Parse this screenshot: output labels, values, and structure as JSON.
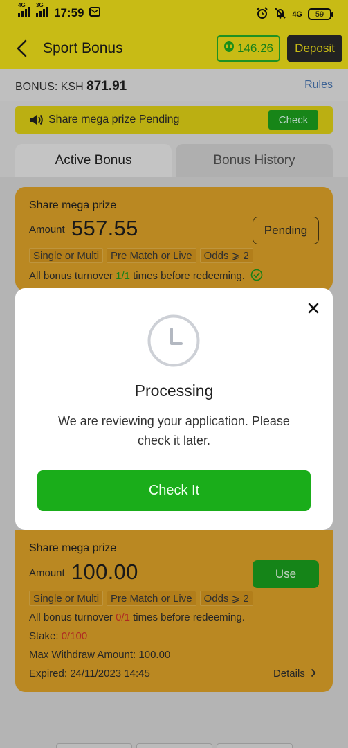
{
  "status_bar": {
    "net1": "4G",
    "net2": "3G",
    "time": "17:59",
    "net3": "4G",
    "battery": "59"
  },
  "header": {
    "title": "Sport Bonus",
    "balance": "146.26",
    "deposit_label": "Deposit"
  },
  "bonus_bar": {
    "label": "BONUS: KSH",
    "amount": "871.91",
    "rules_label": "Rules"
  },
  "notice": {
    "text": "Share mega prize Pending",
    "check_label": "Check"
  },
  "tabs": [
    {
      "label": "Active Bonus"
    },
    {
      "label": "Bonus History"
    }
  ],
  "cards": [
    {
      "title": "Share mega prize",
      "amount_label": "Amount",
      "amount": "557.55",
      "action": "Pending",
      "tags": [
        "Single or Multi",
        "Pre Match or Live",
        "Odds ⩾ 2"
      ],
      "turnover_prefix": "All bonus turnover",
      "turnover_value": "1/1",
      "turnover_suffix": "times before redeeming."
    },
    {
      "title": "Share mega prize",
      "amount_label": "Amount",
      "amount": "100.00",
      "action": "Use",
      "tags": [
        "Single or Multi",
        "Pre Match or Live",
        "Odds ⩾ 2"
      ],
      "turnover_prefix": "All bonus turnover",
      "turnover_value": "0/1",
      "turnover_suffix": "times before redeeming.",
      "stake_label": "Stake:",
      "stake_value": "0/100",
      "max_withdraw": "Max Withdraw Amount: 100.00",
      "expired": "Expired: 24/11/2023 14:45",
      "details_label": "Details"
    }
  ],
  "modal": {
    "title": "Processing",
    "message": "We are reviewing your application. Please check it later.",
    "button_label": "Check It"
  },
  "colors": {
    "brand_yellow": "#f5e51a",
    "card_orange": "#e3a72a",
    "green": "#1aad1a",
    "red": "#d6332a"
  }
}
